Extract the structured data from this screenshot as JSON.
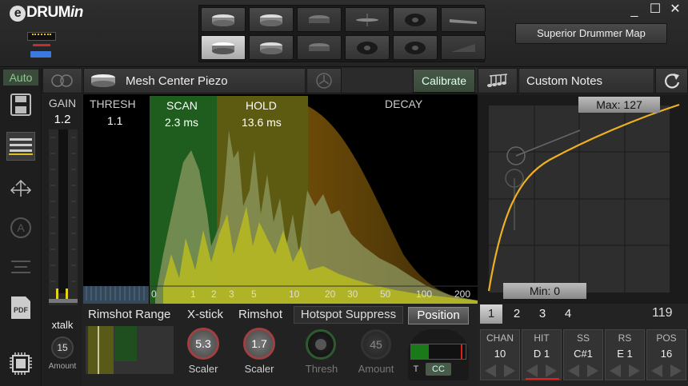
{
  "app": {
    "logo_e": "e",
    "logo_drum": "DRUM",
    "logo_in": "in",
    "sd_map_label": "Superior Drummer Map",
    "min_glyph": "_",
    "max_glyph": "☐",
    "close_glyph": "✕"
  },
  "sidebar": {
    "auto_label": "Auto"
  },
  "padrow": {
    "pad_name": "Mesh Center Piezo",
    "calibrate_label": "Calibrate",
    "notes_label": "Custom Notes"
  },
  "gain": {
    "label": "GAIN",
    "value": "1.2",
    "xtalk_label": "xtalk",
    "xtalk_value": "15",
    "amount_label": "Amount"
  },
  "graph": {
    "thresh_label": "THRESH",
    "thresh_value": "1.1",
    "scan_label": "SCAN",
    "scan_value": "2.3 ms",
    "hold_label": "HOLD",
    "hold_value": "13.6 ms",
    "decay_label": "DECAY",
    "axis_ticks": [
      "0",
      "1",
      "2",
      "3",
      "5",
      "10",
      "20",
      "30",
      "50",
      "100",
      "200"
    ]
  },
  "curve": {
    "max_label": "Max: 127",
    "min_label": "Min: 0"
  },
  "bottom": {
    "rimshot_range_label": "Rimshot Range",
    "xstick_label": "X-stick",
    "xstick_value": "5.3",
    "xstick_sub": "Scaler",
    "rimshot_label": "Rimshot",
    "rimshot_value": "1.7",
    "rimshot_sub": "Scaler",
    "hotspot_label": "Hotspot Suppress",
    "thresh_sub": "Thresh",
    "amount_value": "45",
    "amount_sub": "Amount",
    "position_label": "Position",
    "t_label": "T",
    "cc_label": "CC"
  },
  "midi": {
    "tabs": [
      "1",
      "2",
      "3",
      "4"
    ],
    "count": "119",
    "cells": [
      {
        "h": "CHAN",
        "v": "10"
      },
      {
        "h": "HIT",
        "v": "D 1"
      },
      {
        "h": "SS",
        "v": "C#1"
      },
      {
        "h": "RS",
        "v": "E 1"
      },
      {
        "h": "POS",
        "v": "16"
      }
    ]
  },
  "colors": {
    "scan": "#2b7a2b",
    "hold": "#7a7a1a",
    "decay": "#7a4a0a",
    "curve": "#f0b020",
    "accent_red": "#e02020"
  }
}
